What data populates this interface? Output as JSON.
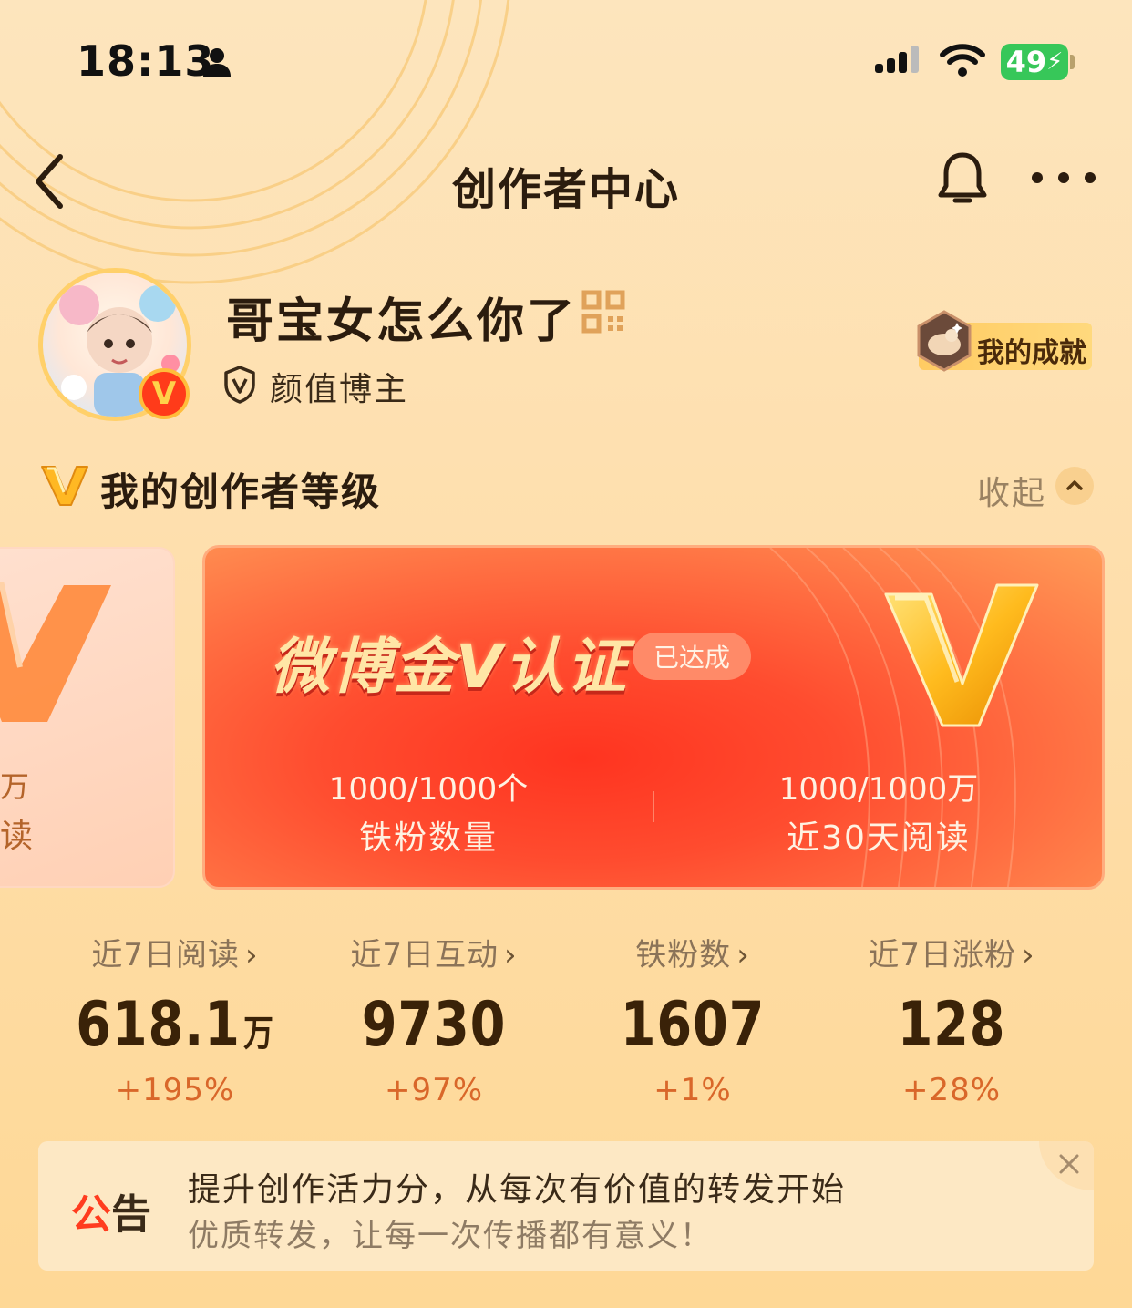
{
  "status_bar": {
    "time": "18:13",
    "battery": "49"
  },
  "nav": {
    "title": "创作者中心",
    "icons": [
      "back-icon",
      "bell-icon",
      "more-icon"
    ]
  },
  "profile": {
    "username": "哥宝女怎么你了",
    "tag": "颜值博主",
    "verified_mark": "V",
    "achievement_label": "我的成就"
  },
  "level": {
    "title": "我的创作者等级",
    "collapse_label": "收起"
  },
  "prev_card": {
    "partial_text_1": "万",
    "partial_text_2": "读"
  },
  "v_card": {
    "title": "微博金V认证",
    "status": "已达成",
    "stats": [
      {
        "value": "1000/1000",
        "unit": "个",
        "label": "铁粉数量"
      },
      {
        "value": "1000/1000",
        "unit": "万",
        "label": "近30天阅读"
      }
    ]
  },
  "metrics": [
    {
      "label": "近7日阅读",
      "value": "618.1",
      "unit": "万",
      "change": "+195%"
    },
    {
      "label": "近7日互动",
      "value": "9730",
      "unit": "",
      "change": "+97%"
    },
    {
      "label": "铁粉数",
      "value": "1607",
      "unit": "",
      "change": "+1%"
    },
    {
      "label": "近7日涨粉",
      "value": "128",
      "unit": "",
      "change": "+28%"
    }
  ],
  "notice": {
    "tag_a": "公",
    "tag_b": "告",
    "line1": "提升创作活力分，从每次有价值的转发开始",
    "line2": "优质转发，让每一次传播都有意义！"
  },
  "colors": {
    "accent": "#ff3c1f",
    "gold": "#ffc53a",
    "background": "#fde2b2"
  }
}
